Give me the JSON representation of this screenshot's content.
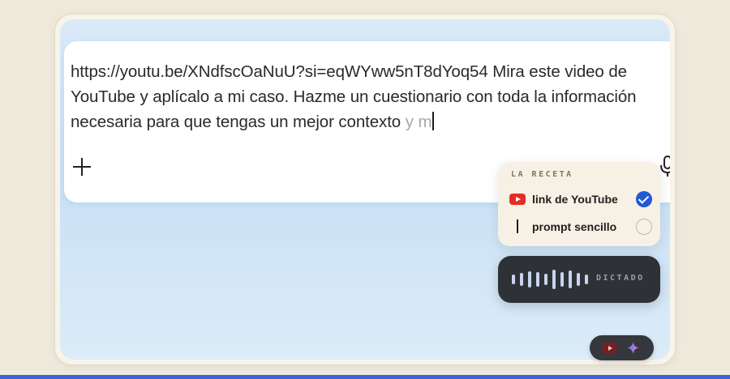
{
  "prompt": {
    "typed_text": "https://youtu.be/XNdfscOaNuU?si=eqWYww5nT8dYoq54 Mira este video de YouTube y aplícalo a mi caso. Hazme un cuestionario con toda la información necesaria para que tengas un mejor contexto",
    "ghost_text": " y m"
  },
  "toolbar": {
    "add_icon": "plus-icon",
    "mic_icon": "microphone-icon"
  },
  "recipe": {
    "title": "LA RECETA",
    "items": [
      {
        "label": "link de YouTube",
        "icon": "youtube-icon",
        "checked": true
      },
      {
        "label": "prompt sencillo",
        "icon": "text-cursor-icon",
        "checked": false
      }
    ]
  },
  "dictation": {
    "label": "DICTADO",
    "icon": "waveform-icon"
  },
  "badges": {
    "icons": [
      "youtube-icon",
      "gemini-sparkle-icon"
    ]
  },
  "colors": {
    "accent_blue": "#2058d6",
    "youtube_red": "#e52d27",
    "dark_pill": "#2e3236",
    "panel_cream": "#f6f1e4"
  }
}
